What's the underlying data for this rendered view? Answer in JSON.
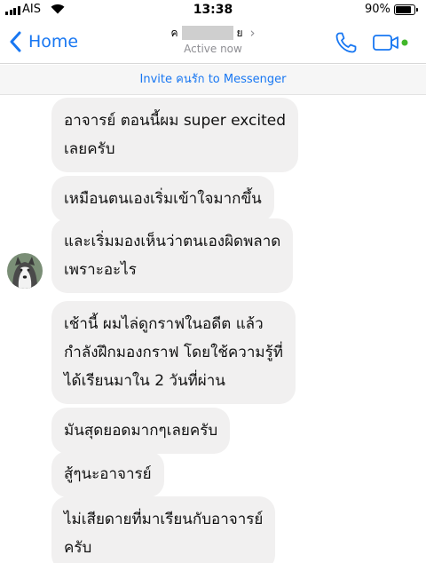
{
  "status_bar": {
    "carrier": "AIS",
    "time": "13:38",
    "battery_percent": "90%",
    "battery_level": 0.9,
    "icons": [
      "signal-icon",
      "wifi-icon",
      "battery-icon"
    ]
  },
  "nav": {
    "back_label": "Home",
    "contact_initial": "ค",
    "contact_final": "ย",
    "status": "Active now",
    "icons": [
      "back-chevron-icon",
      "call-icon",
      "video-call-icon"
    ],
    "accent_color": "#1877f2",
    "online_color": "#42b72a"
  },
  "invite": {
    "label": "Invite คนรัก to Messenger"
  },
  "messages": [
    {
      "text": "อาจารย์ ตอนนี้ผม super excited\nเลยครับ"
    },
    {
      "text": "เหมือนตนเองเริ่มเข้าใจมากขึ้น"
    },
    {
      "text": "และเริ่มมองเห็นว่าตนเองผิดพลาด\nเพราะอะไร"
    },
    {
      "text": "เช้านี้ ผมไล่ดูกราฟในอดีต แล้ว\nกำลังฝึกมองกราฟ โดยใช้ความรู้ที่\nได้เรียนมาใน 2 วันที่ผ่าน"
    },
    {
      "text": "มันสุดยอดมากๆเลยครับ"
    },
    {
      "text": "สู้ๆนะอาจารย์"
    },
    {
      "text": "ไม่เสียดายที่มาเรียนกับอาจารย์\nครับ"
    }
  ]
}
